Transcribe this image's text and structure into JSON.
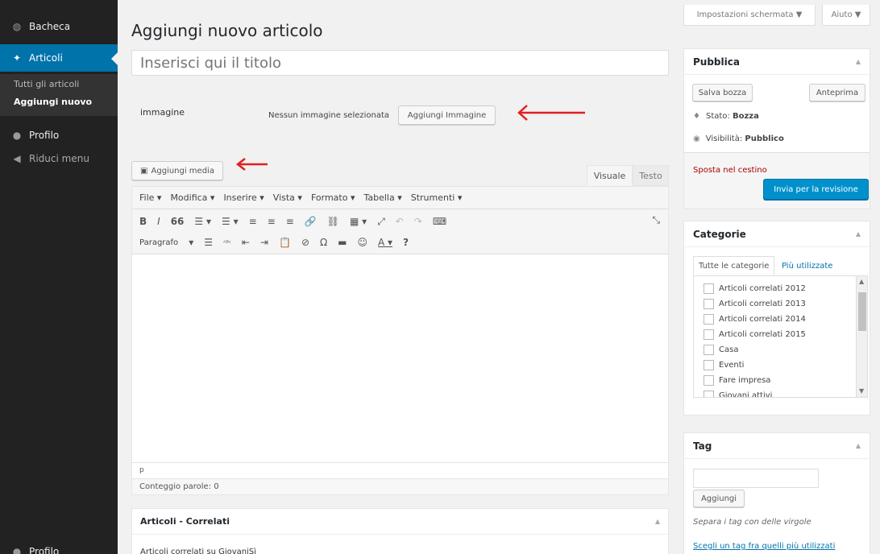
{
  "sidebar": {
    "items": [
      {
        "label": "Bacheca",
        "icon": "dashboard-icon"
      },
      {
        "label": "Articoli",
        "icon": "pin-icon"
      },
      {
        "label": "Profilo",
        "icon": "user-icon"
      },
      {
        "label": "Riduci menu",
        "icon": "collapse-icon"
      }
    ],
    "submenu": [
      "Tutti gli articoli",
      "Aggiungi nuovo"
    ],
    "bottom_item": "Profilo"
  },
  "header": {
    "screen_options": "Impostazioni schermata ▼",
    "help": "Aiuto ▼"
  },
  "main": {
    "page_title": "Aggiungi nuovo articolo",
    "title_placeholder": "Inserisci qui il titolo",
    "image_label": "immagine",
    "no_image_text": "Nessun immagine selezionata",
    "add_image_button": "Aggiungi Immagine",
    "add_media_button": "Aggiungi media"
  },
  "editor": {
    "tabs": [
      "Visuale",
      "Testo"
    ],
    "menus": [
      "File ▾",
      "Modifica ▾",
      "Inserire ▾",
      "Vista ▾",
      "Formato ▾",
      "Tabella ▾",
      "Strumenti ▾"
    ],
    "toolbar_row1": [
      "B",
      "I",
      "66",
      "☰ ▾",
      "☰ ▾",
      "≡",
      "≡",
      "≡",
      "🔗",
      "⛓",
      "▦ ▾",
      "⤢",
      "↶",
      "↷",
      "⌨"
    ],
    "format_select": "Paragrafo",
    "toolbar_row2": [
      "▾",
      "☰",
      "ᴬᴮᶜ",
      "⇤",
      "⇥",
      "📋",
      "⊘",
      "Ω",
      "▬",
      "☺",
      "A ▾",
      "?"
    ],
    "fullscreen": "⤡",
    "path": "p",
    "word_count": "Conteggio parole: 0"
  },
  "related": {
    "title": "Articoli - Correlati",
    "subtitle": "Articoli correlati su GiovaniSì"
  },
  "publish": {
    "title": "Pubblica",
    "save_draft": "Salva bozza",
    "preview": "Anteprima",
    "status_label": "Stato:",
    "status_value": "Bozza",
    "visibility_label": "Visibilità:",
    "visibility_value": "Pubblico",
    "trash": "Sposta nel cestino",
    "submit": "Invia per la revisione"
  },
  "categories": {
    "title": "Categorie",
    "tab_all": "Tutte le categorie",
    "tab_popular": "Più utilizzate",
    "items": [
      "Articoli correlati 2012",
      "Articoli correlati 2013",
      "Articoli correlati 2014",
      "Articoli correlati 2015",
      "Casa",
      "Eventi",
      "Fare impresa",
      "Giovani attivi"
    ]
  },
  "tags": {
    "title": "Tag",
    "add_button": "Aggiungi",
    "hint": "Separa i tag con delle virgole",
    "choose_link": "Scegli un tag fra quelli più utilizzati"
  },
  "colors": {
    "accent": "#0073aa",
    "sidebar": "#222222",
    "annotation_arrow": "#e02020",
    "trash": "#aa0000"
  }
}
